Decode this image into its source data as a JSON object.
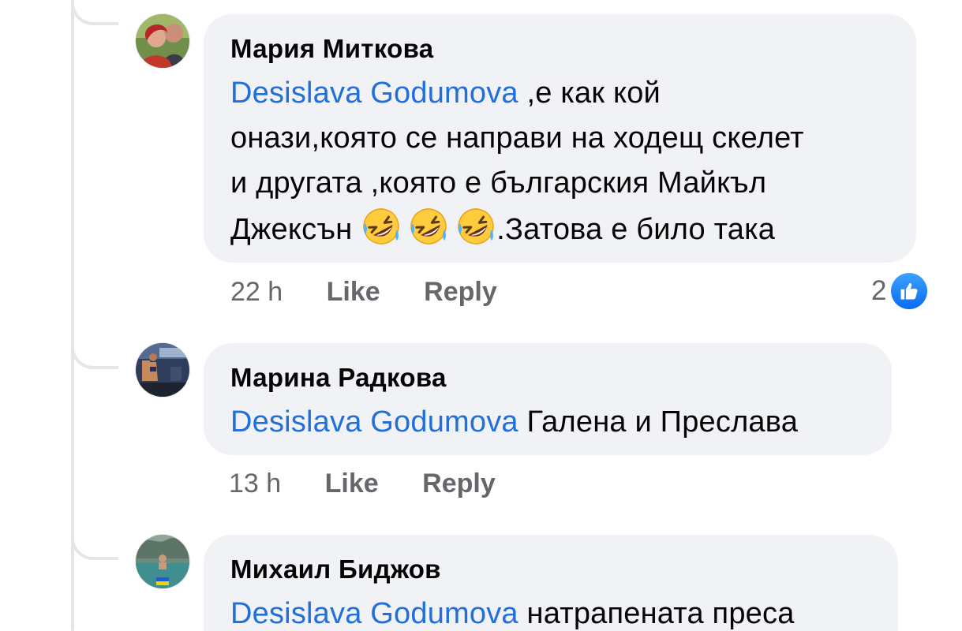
{
  "comments": [
    {
      "author": "Мария Миткова",
      "mention": "Desislava Godumova",
      "text_line1": " ,е как кой",
      "text_line2": "онази,която се направи на ходещ скелет",
      "text_line3": "и другата ,която е българския Майкъл",
      "text_line4_before": "Джексън ",
      "text_line4_after": ".Затова е било така",
      "emojis": [
        "rolling-on-floor-laughing",
        "rolling-on-floor-laughing",
        "rolling-on-floor-laughing"
      ],
      "time": "22 h",
      "like_label": "Like",
      "reply_label": "Reply",
      "reaction_count": "2",
      "reaction_type": "like-icon"
    },
    {
      "author": "Марина Радкова",
      "mention": "Desislava Godumova",
      "text": " Галена и Преслава",
      "time": "13 h",
      "like_label": "Like",
      "reply_label": "Reply"
    },
    {
      "author": "Михаил Биджов",
      "mention": "Desislava Godumova",
      "text": " натрапената преса"
    }
  ],
  "colors": {
    "bubble_bg": "#f0f2f5",
    "mention": "#216fdb",
    "meta_text": "#65676b",
    "like_blue": "#1877f2",
    "thread_line": "#e4e6eb"
  }
}
